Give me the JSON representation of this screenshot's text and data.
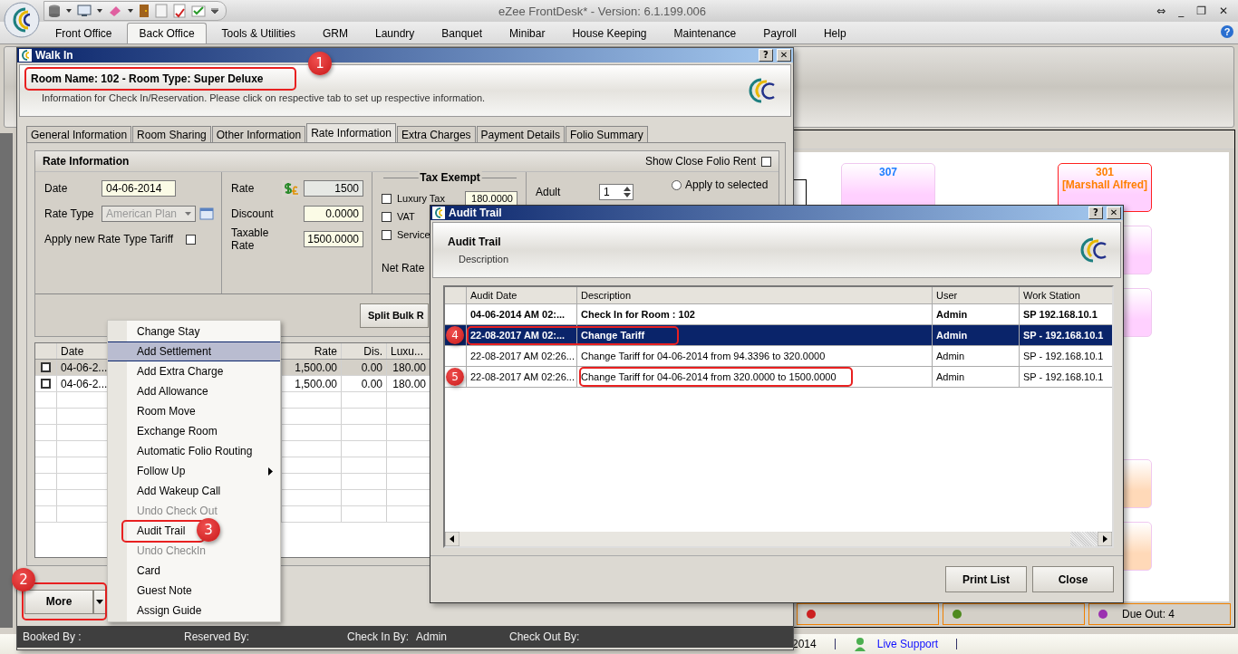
{
  "app": {
    "title": "eZee FrontDesk* - Version: 6.1.199.006",
    "controls": [
      "⇔",
      "_",
      "❐",
      "✕"
    ]
  },
  "menu": [
    {
      "label": "Front Office",
      "selected": false
    },
    {
      "label": "Back Office",
      "selected": true
    },
    {
      "label": "Tools & Utilities",
      "selected": false
    },
    {
      "label": "GRM",
      "selected": false
    },
    {
      "label": "Laundry",
      "selected": false
    },
    {
      "label": "Banquet",
      "selected": false
    },
    {
      "label": "Minibar",
      "selected": false
    },
    {
      "label": "House Keeping",
      "selected": false
    },
    {
      "label": "Maintenance",
      "selected": false
    },
    {
      "label": "Payroll",
      "selected": false
    },
    {
      "label": "Help",
      "selected": false
    }
  ],
  "help": "?",
  "room_columns": [
    {
      "tiles": [
        {
          "label": {
            "number": "307",
            "color": "#1e7fff"
          },
          "color": "#ffd0ff",
          "alert": false
        }
      ]
    },
    {
      "tiles": [
        {
          "label": {
            "number": "301",
            "guest": "[Marshall Alfred]",
            "color": "#ff7f00"
          },
          "color": "#ffd0ff",
          "alert": true
        },
        {
          "color": "#ffd0ff",
          "alert": false
        },
        {
          "color": "#ffd0ff",
          "alert": false
        },
        {
          "color": "#ffd9b8",
          "alert": false
        },
        {
          "color": "#ffd9b8",
          "alert": false
        }
      ]
    }
  ],
  "counters": [
    {
      "color": "#cc2020"
    },
    {
      "color": "#4f8a1f"
    },
    {
      "color": "#9b30b0",
      "label": "Due Out: 4"
    }
  ],
  "status_bar": {
    "date": "2014",
    "link": "Live Support"
  },
  "walk_in": {
    "title": "Walk In",
    "controls": [
      "?",
      "✕"
    ],
    "room_heading": "Room Name: 102 - Room Type: Super Deluxe",
    "heading_callout": "1",
    "info": "Information for Check In/Reservation. Please click on respective tab to set up respective information.",
    "tabs": [
      {
        "label": "General Information",
        "selected": false
      },
      {
        "label": "Room Sharing",
        "selected": false
      },
      {
        "label": "Other Information",
        "selected": false
      },
      {
        "label": "Rate Information",
        "selected": true
      },
      {
        "label": "Extra Charges",
        "selected": false
      },
      {
        "label": "Payment Details",
        "selected": false
      },
      {
        "label": "Folio Summary",
        "selected": false
      }
    ],
    "rate_panel": {
      "title": "Rate Information",
      "show_close_folio": {
        "label": "Show Close Folio Rent",
        "checked": false
      },
      "date": {
        "label": "Date",
        "value": "04-06-2014"
      },
      "rate_type": {
        "label": "Rate Type",
        "value": "American Plan",
        "disabled": true
      },
      "apply_tariff": {
        "label": "Apply new Rate Type Tariff",
        "checked": false
      },
      "rate": {
        "label": "Rate",
        "value": "1500"
      },
      "discount": {
        "label": "Discount",
        "value": "0.0000"
      },
      "taxable_rate": {
        "label": "Taxable Rate",
        "value": "1500.0000"
      },
      "tax_exempt": {
        "title": "Tax Exempt",
        "items": [
          {
            "label": "Luxury Tax",
            "checked": false,
            "value": "180.0000"
          },
          {
            "label": "VAT",
            "checked": false
          },
          {
            "label": "Service",
            "checked": false
          }
        ]
      },
      "net_rate": "Net Rate",
      "adult": {
        "label": "Adult",
        "value": "1"
      },
      "apply_selected": {
        "label": "Apply to selected",
        "selected": false
      },
      "split_button": "Split Bulk R"
    },
    "grid": {
      "columns": [
        "Date",
        "Rate",
        "Dis.",
        "Luxu..."
      ],
      "rows": [
        {
          "checked": false,
          "selected": true,
          "date": "04-06-2...",
          "rate": "1,500.00",
          "dis": "0.00",
          "luxury": "180.00"
        },
        {
          "checked": false,
          "selected": false,
          "date": "04-06-2...",
          "rate": "1,500.00",
          "dis": "0.00",
          "luxury": "180.00"
        }
      ]
    },
    "more_button": {
      "label": "More",
      "callout": "2"
    },
    "footer": [
      {
        "label": "Booked By :"
      },
      {
        "label": "Reserved By:"
      },
      {
        "label": "Check In By:",
        "value": "Admin"
      },
      {
        "label": "Check Out By:"
      }
    ]
  },
  "context_menu": [
    {
      "label": "Change Stay",
      "disabled": false,
      "selected": false
    },
    {
      "label": "Add Settlement",
      "disabled": false,
      "selected": true
    },
    {
      "label": "Add Extra Charge",
      "disabled": false,
      "selected": false
    },
    {
      "label": "Add Allowance",
      "disabled": false,
      "selected": false
    },
    {
      "label": "Room Move",
      "disabled": false,
      "selected": false
    },
    {
      "label": "Exchange Room",
      "disabled": false,
      "selected": false
    },
    {
      "label": "Automatic Folio Routing",
      "disabled": false,
      "selected": false
    },
    {
      "label": "Follow Up",
      "disabled": false,
      "selected": false,
      "submenu": true
    },
    {
      "label": "Add Wakeup Call",
      "disabled": false,
      "selected": false
    },
    {
      "label": "Undo Check Out",
      "disabled": true,
      "selected": false
    },
    {
      "label": "Audit Trail",
      "disabled": false,
      "selected": false,
      "callout": "3"
    },
    {
      "label": "Undo CheckIn",
      "disabled": true,
      "selected": false
    },
    {
      "label": "Card",
      "disabled": false,
      "selected": false
    },
    {
      "label": "Guest Note",
      "disabled": false,
      "selected": false
    },
    {
      "label": "Assign Guide",
      "disabled": false,
      "selected": false
    }
  ],
  "audit": {
    "title": "Audit Trail",
    "controls": [
      "?",
      "✕"
    ],
    "heading": "Audit Trail",
    "subheading": "Description",
    "columns": [
      "Audit Date",
      "Description",
      "User",
      "Work Station"
    ],
    "rows": [
      {
        "date": "04-06-2014 AM 02:...",
        "description": "Check In for Room : 102",
        "user": "Admin",
        "station": "SP 192.168.10.1",
        "bold": true,
        "selected": false
      },
      {
        "date": "22-08-2017 AM 02:...",
        "description": "Change Tariff",
        "user": "Admin",
        "station": "SP - 192.168.10.1",
        "bold": true,
        "selected": true,
        "callout": {
          "number": "4",
          "kind": "wide"
        }
      },
      {
        "date": "22-08-2017 AM 02:26...",
        "description": "Change Tariff for 04-06-2014 from 94.3396 to 320.0000",
        "user": "Admin",
        "station": "SP - 192.168.10.1",
        "bold": false,
        "selected": false
      },
      {
        "date": "22-08-2017 AM 02:26...",
        "description": "Change Tariff for 04-06-2014 from 320.0000 to 1500.0000",
        "user": "Admin",
        "station": "SP - 192.168.10.1",
        "bold": false,
        "selected": false,
        "callout": {
          "number": "5",
          "kind": "cell"
        }
      }
    ],
    "buttons": [
      "Print List",
      "Close"
    ]
  }
}
